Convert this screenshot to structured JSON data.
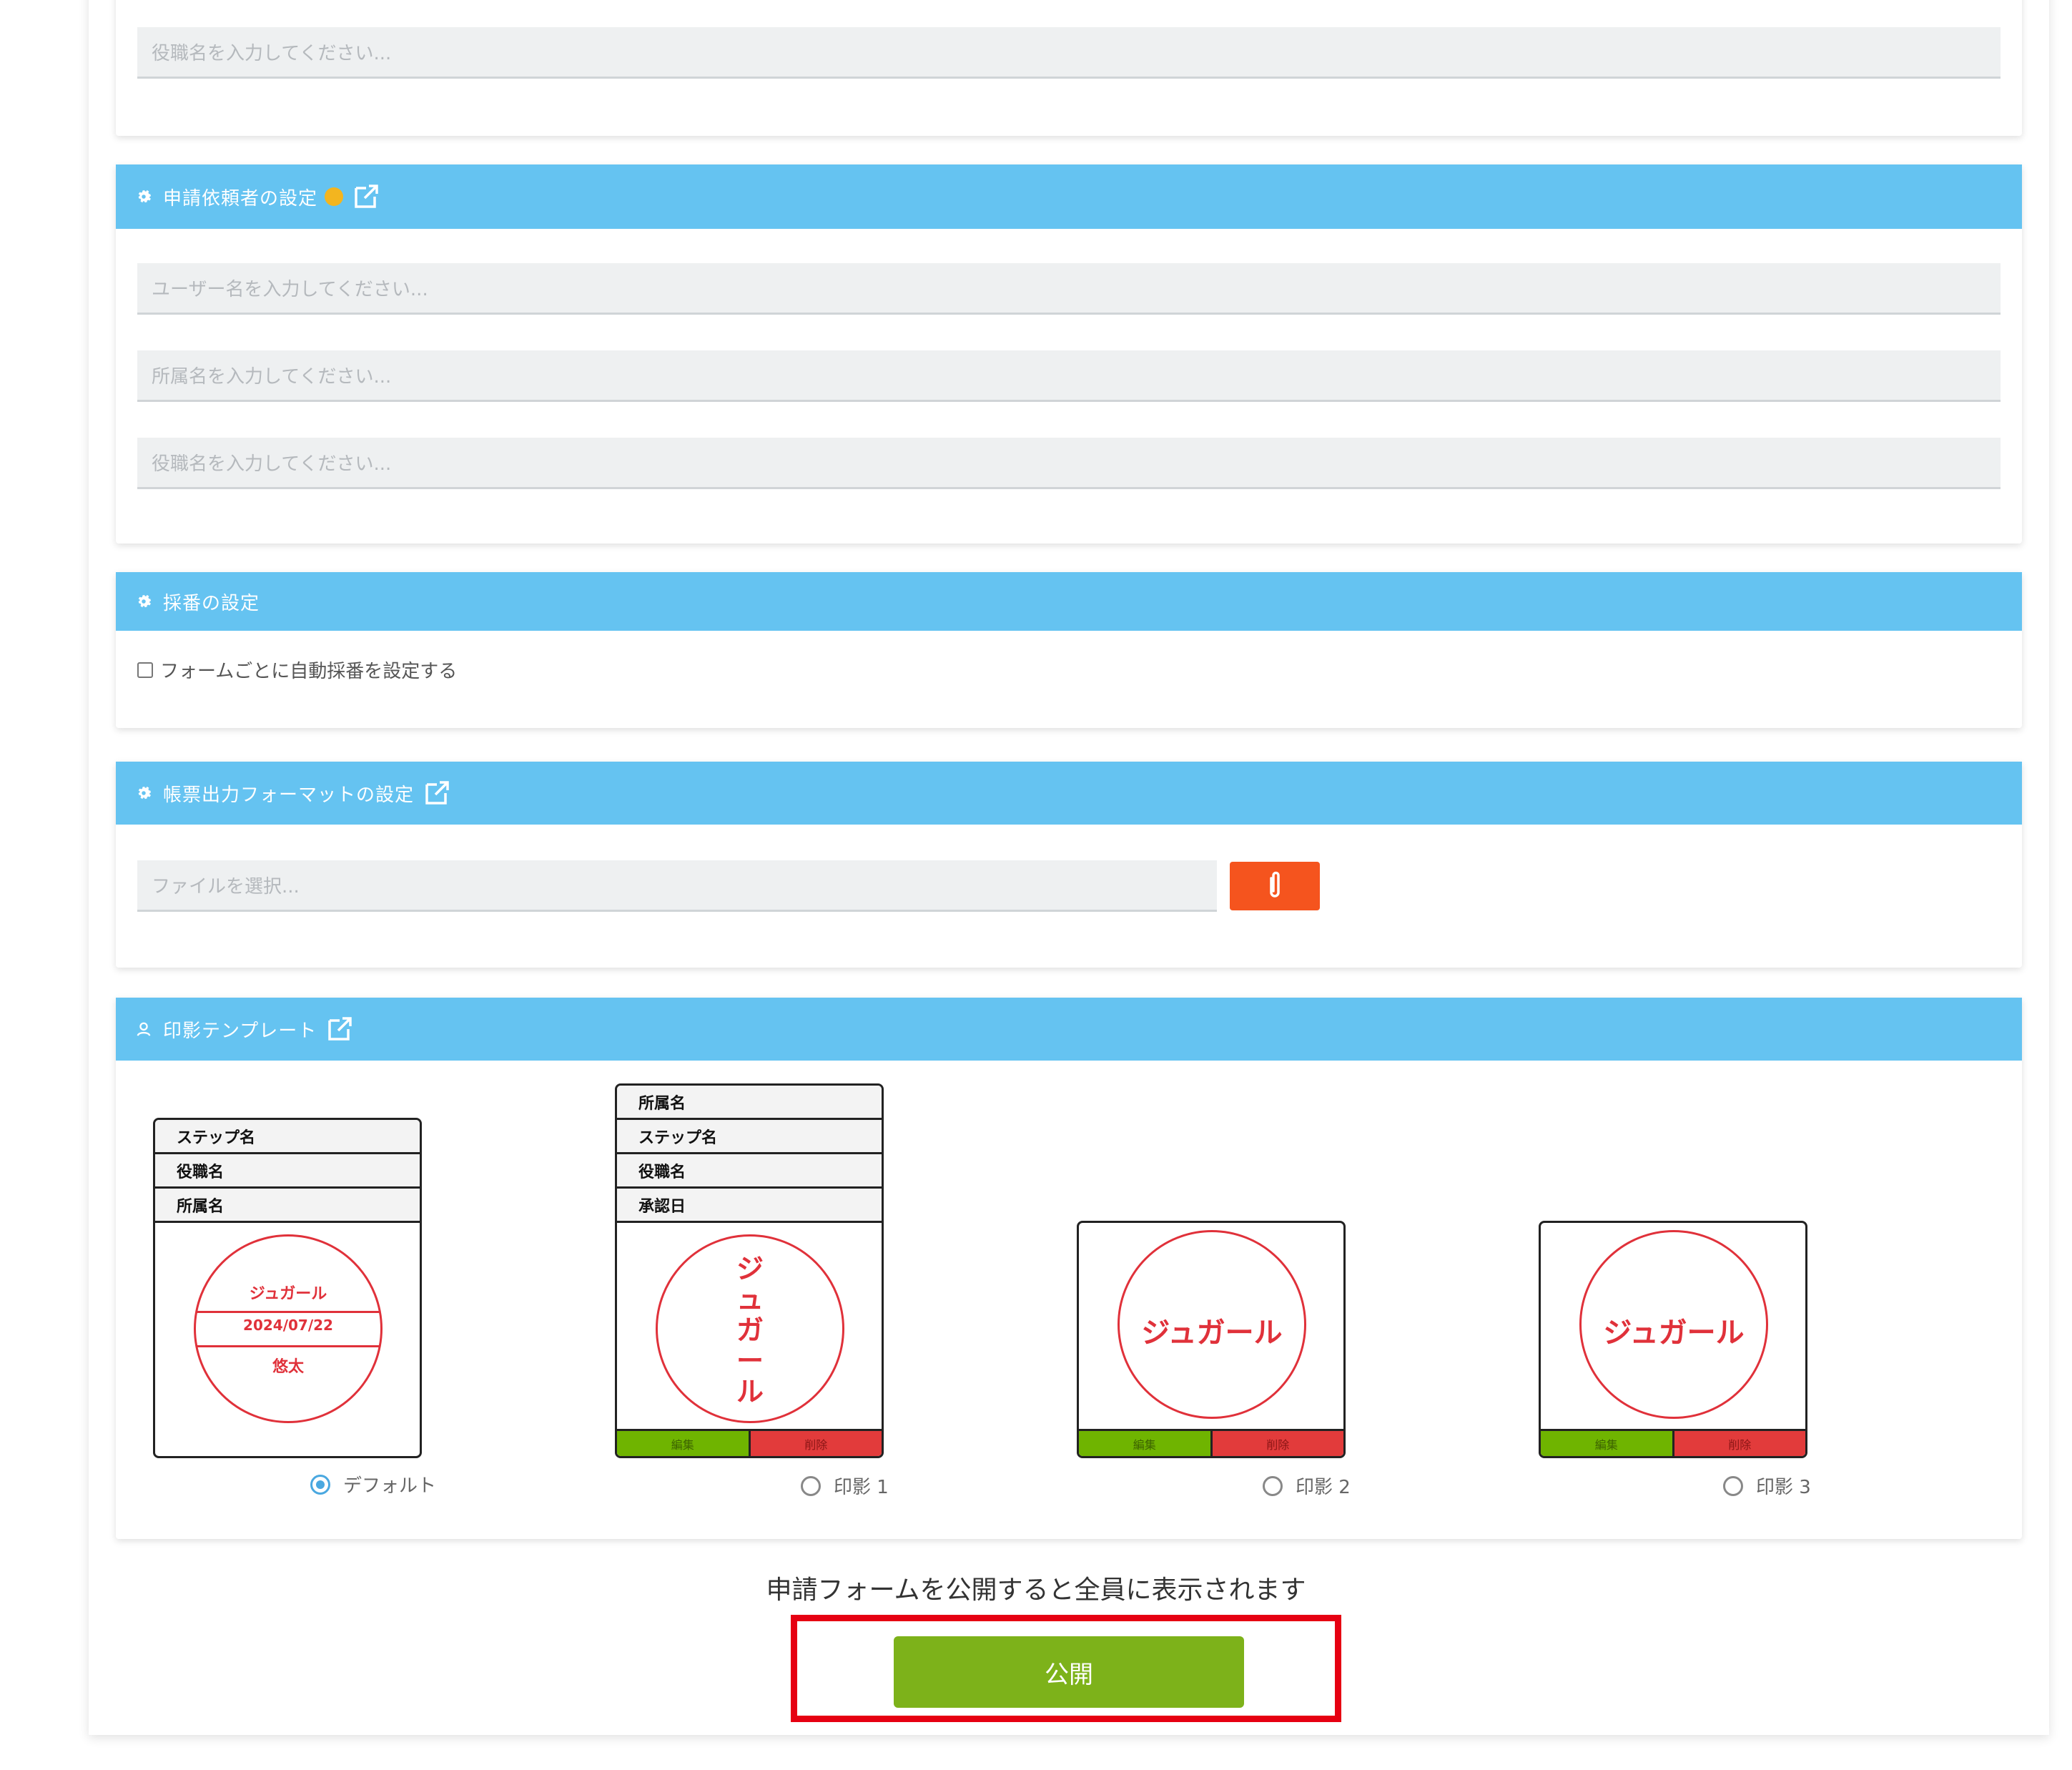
{
  "top_section": {
    "position_placeholder": "役職名を入力してください..."
  },
  "requester_section": {
    "title": "申請依頼者の設定",
    "user_placeholder": "ユーザー名を入力してください...",
    "department_placeholder": "所属名を入力してください...",
    "position_placeholder": "役職名を入力してください..."
  },
  "numbering_section": {
    "title": "採番の設定",
    "checkbox_label": "フォームごとに自動採番を設定する"
  },
  "format_section": {
    "title": "帳票出力フォーマットの設定",
    "file_placeholder": "ファイルを選択..."
  },
  "stamp_section": {
    "title": "印影テンプレート",
    "templates": [
      {
        "rows": [
          "ステップ名",
          "役職名",
          "所属名"
        ],
        "circle_top": "ジュガール",
        "circle_date": "2024/07/22",
        "circle_bottom": "悠太",
        "radio_label": "デフォルト",
        "selected": true
      },
      {
        "rows": [
          "所属名",
          "ステップ名",
          "役職名",
          "承認日"
        ],
        "circle_vertical": [
          "ジ",
          "ュ",
          "ガ",
          "ー",
          "ル"
        ],
        "edit_label": "編集",
        "delete_label": "削除",
        "radio_label": "印影 1",
        "selected": false
      },
      {
        "circle_text": "ジュガール",
        "edit_label": "編集",
        "delete_label": "削除",
        "radio_label": "印影 2",
        "selected": false
      },
      {
        "circle_text": "ジュガール",
        "edit_label": "編集",
        "delete_label": "削除",
        "radio_label": "印影 3",
        "selected": false
      }
    ]
  },
  "footer": {
    "notice": "申請フォームを公開すると全員に表示されます",
    "publish_label": "公開"
  },
  "colors": {
    "header_blue": "#65c3f1",
    "attach_orange": "#f5541e",
    "publish_green": "#7db21a",
    "highlight_red": "#e60012",
    "stamp_red": "#e0313a"
  }
}
